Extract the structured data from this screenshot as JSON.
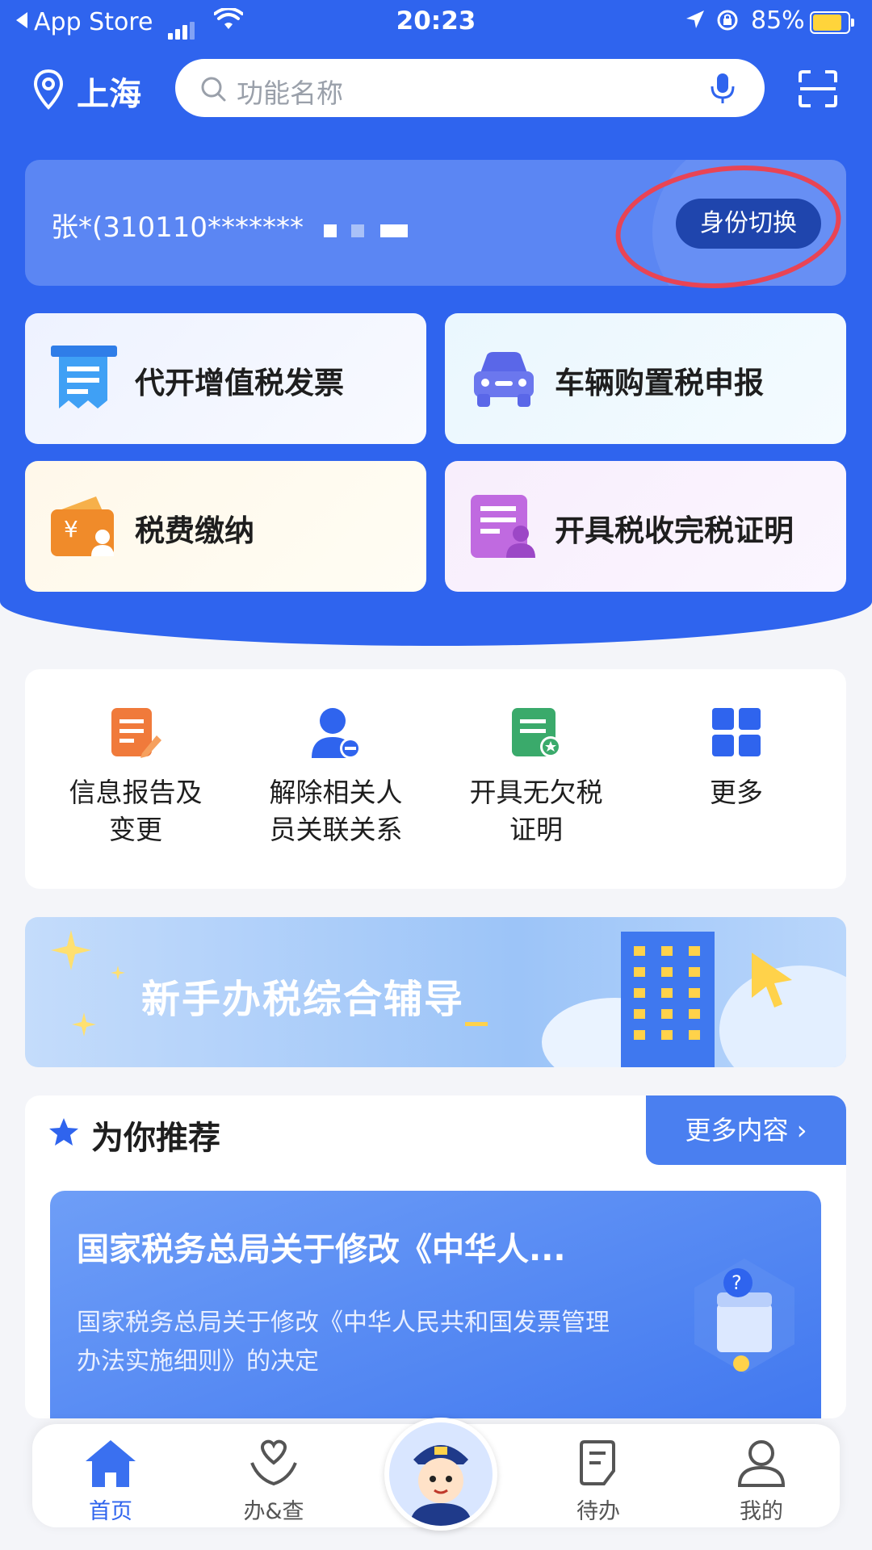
{
  "status_bar": {
    "back_app": "App Store",
    "time": "20:23",
    "battery_percent": "85%"
  },
  "header": {
    "city": "上海",
    "search_placeholder": "功能名称"
  },
  "identity": {
    "name": "张*(310110*******",
    "switch_label": "身份切换"
  },
  "quick_tiles": [
    {
      "label": "代开增值税发票",
      "icon": "invoice-icon",
      "color": "#2f7de8"
    },
    {
      "label": "车辆购置税申报",
      "icon": "car-icon",
      "color": "#5a67e8"
    },
    {
      "label": "税费缴纳",
      "icon": "wallet-icon",
      "color": "#f08b2a"
    },
    {
      "label": "开具税收完税证明",
      "icon": "certificate-icon",
      "color": "#b45cd8"
    }
  ],
  "services": [
    {
      "line1": "信息报告及",
      "line2": "变更",
      "icon": "report-edit-icon",
      "color": "#f07a3b"
    },
    {
      "line1": "解除相关人",
      "line2": "员关联关系",
      "icon": "person-remove-icon",
      "color": "#2f64ee"
    },
    {
      "line1": "开具无欠税",
      "line2": "证明",
      "icon": "certificate-star-icon",
      "color": "#3aaa6b"
    },
    {
      "line1": "更多",
      "line2": "",
      "icon": "grid-icon",
      "color": "#2f64ee"
    }
  ],
  "banner": {
    "text": "新手办税综合辅导"
  },
  "recommend": {
    "title": "为你推荐",
    "more_label": "更多内容",
    "news_title": "国家税务总局关于修改《中华人...",
    "news_summary": "国家税务总局关于修改《中华人民共和国发票管理办法实施细则》的决定"
  },
  "tabbar": [
    {
      "label": "首页",
      "icon": "home-icon",
      "active": true
    },
    {
      "label": "办&查",
      "icon": "heart-hand-icon",
      "active": false
    },
    {
      "label": "待办",
      "icon": "todo-icon",
      "active": false
    },
    {
      "label": "我的",
      "icon": "user-icon",
      "active": false
    }
  ],
  "colors": {
    "brand_blue": "#2f64ee",
    "highlight_circle": "#e84455"
  }
}
